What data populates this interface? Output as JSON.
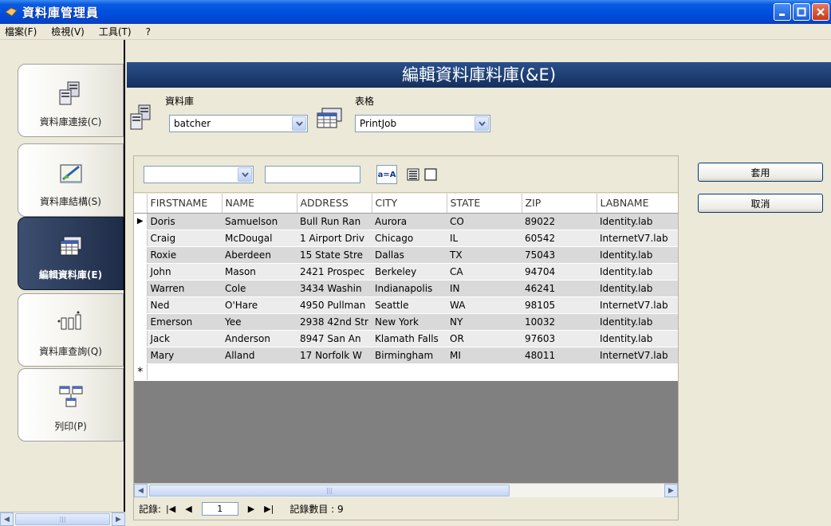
{
  "window": {
    "title": "資料庫管理員"
  },
  "menu": [
    "檔案(F)",
    "檢視(V)",
    "工具(T)",
    "?"
  ],
  "nav": [
    {
      "label": "資料庫連接(C)",
      "icon": "database-connect-icon",
      "active": false
    },
    {
      "label": "資料庫結構(S)",
      "icon": "database-structure-icon",
      "active": false
    },
    {
      "label": "編輯資料庫(E)",
      "icon": "edit-database-icon",
      "active": true
    },
    {
      "label": "資料庫查詢(Q)",
      "icon": "database-query-icon",
      "active": false
    },
    {
      "label": "列印(P)",
      "icon": "print-icon",
      "active": false
    }
  ],
  "header": {
    "title": "編輯資料庫料庫(&E)"
  },
  "database": {
    "label": "資料庫",
    "value": "batcher"
  },
  "table_select": {
    "label": "表格",
    "value": "PrintJob"
  },
  "buttons": {
    "apply": "套用",
    "cancel": "取消"
  },
  "grid": {
    "columns": [
      "FIRSTNAME",
      "NAME",
      "ADDRESS",
      "CITY",
      "STATE",
      "ZIP",
      "LABNAME"
    ],
    "rows": [
      [
        "Doris",
        "Samuelson",
        "Bull Run Ran",
        "Aurora",
        "CO",
        "89022",
        "Identity.lab"
      ],
      [
        "Craig",
        "McDougal",
        "1 Airport Driv",
        "Chicago",
        "IL",
        "60542",
        "InternetV7.lab"
      ],
      [
        "Roxie",
        "Aberdeen",
        "15 State Stre",
        "Dallas",
        "TX",
        "75043",
        "Identity.lab"
      ],
      [
        "John",
        "Mason",
        "2421 Prospec",
        "Berkeley",
        "CA",
        "94704",
        "Identity.lab"
      ],
      [
        "Warren",
        "Cole",
        "3434 Washin",
        "Indianapolis",
        "IN",
        "46241",
        "Identity.lab"
      ],
      [
        "Ned",
        "O'Hare",
        "4950 Pullman",
        "Seattle",
        "WA",
        "98105",
        "InternetV7.lab"
      ],
      [
        "Emerson",
        "Yee",
        "2938 42nd Str",
        "New York",
        "NY",
        "10032",
        "Identity.lab"
      ],
      [
        "Jack",
        "Anderson",
        "8947 San An",
        "Klamath Falls",
        "OR",
        "97603",
        "Identity.lab"
      ],
      [
        "Mary",
        "Alland",
        "17 Norfolk W",
        "Birmingham",
        "MI",
        "48011",
        "InternetV7.lab"
      ]
    ]
  },
  "record": {
    "label": "記錄:",
    "current": "1",
    "count_label": "記錄數目 : 9"
  },
  "toolbar": {
    "case_button": "a=A"
  }
}
